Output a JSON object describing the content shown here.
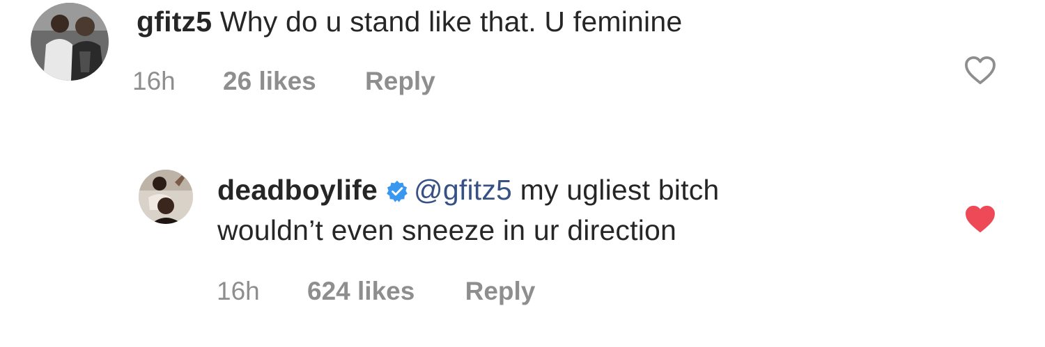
{
  "comments": [
    {
      "username": "gfitz5",
      "text": "Why do u stand like that. U feminine",
      "time": "16h",
      "likes": "26 likes",
      "reply_label": "Reply",
      "liked": false,
      "verified": false,
      "icon": "heart-outline-icon"
    },
    {
      "username": "deadboylife",
      "mention": "@gfitz5",
      "text_line1": "my ugliest bitch",
      "text_line2": "wouldn’t even sneeze in ur direction",
      "time": "16h",
      "likes": "624 likes",
      "reply_label": "Reply",
      "liked": true,
      "verified": true,
      "icon": "heart-filled-icon"
    }
  ],
  "colors": {
    "text": "#262626",
    "meta": "#8e8e8e",
    "mention": "#385185",
    "verified": "#3897f0",
    "liked_heart": "#ed4956"
  }
}
